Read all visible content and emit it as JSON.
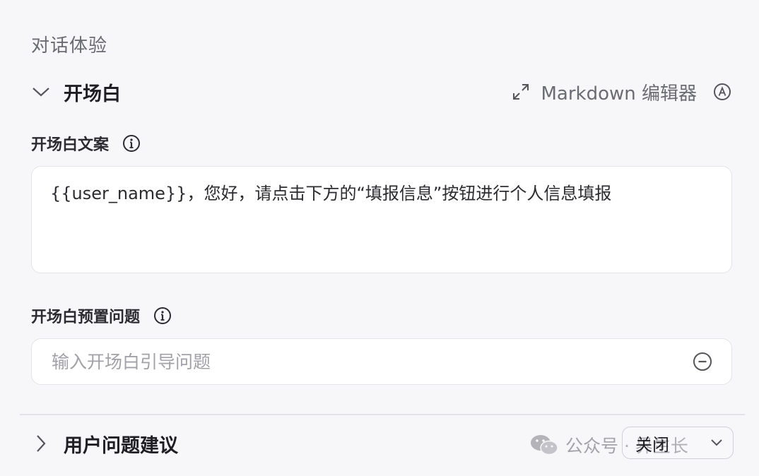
{
  "section": {
    "title": "对话体验"
  },
  "opening": {
    "title": "开场白",
    "markdown_label": "Markdown 编辑器",
    "text_label": "开场白文案",
    "text_value": "{{user_name}}，您好，请点击下方的“填报信息”按钮进行个人信息填报",
    "preset_label": "开场白预置问题",
    "preset_placeholder": "输入开场白引导问题"
  },
  "suggestions": {
    "title": "用户问题建议",
    "dropdown_value": "关闭"
  },
  "watermark": {
    "text": "公众号 · 界生长"
  },
  "icons": [
    "chevron-down-icon",
    "expand-icon",
    "circle-a-icon",
    "info-icon",
    "minus-circle-icon",
    "chevron-right-icon",
    "wechat-icon",
    "chevron-down-small-icon"
  ],
  "colors": {
    "background": "#f7f7f9",
    "box": "#ffffff",
    "border": "#e4e4e8",
    "muted": "#6b6b73"
  }
}
